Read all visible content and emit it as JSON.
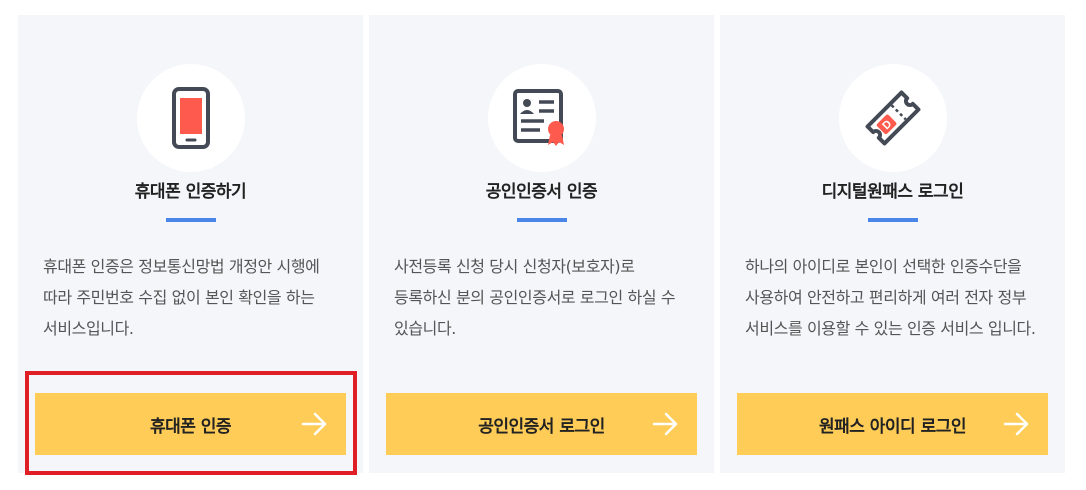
{
  "cards": [
    {
      "icon": "mobile-phone-icon",
      "title": "휴대폰 인증하기",
      "description": "휴대폰 인증은 정보통신망법 개정안 시행에 따라 주민번호 수집 없이 본인 확인을 하는 서비스입니다.",
      "button_label": "휴대폰 인증"
    },
    {
      "icon": "certificate-icon",
      "title": "공인인증서 인증",
      "description": "사전등록 신청 당시 신청자(보호자)로 등록하신 분의 공인인증서로 로그인 하실 수 있습니다.",
      "button_label": "공인인증서 로그인"
    },
    {
      "icon": "digital-onepass-ticket-icon",
      "title": "디지털원패스 로그인",
      "description": "하나의 아이디로 본인이 선택한 인증수단을 사용하여 안전하고 편리하게 여러 전자 정부 서비스를 이용할 수 있는 인증 서비스 입니다.",
      "button_label": "원패스 아이디 로그인"
    }
  ],
  "colors": {
    "card_background": "#f4f6f9",
    "button": "#ffcc57",
    "title_underline": "#4a86e8",
    "highlight": "#e01e26",
    "icon_accent": "#ff5a4e",
    "icon_stroke": "#444a55"
  }
}
